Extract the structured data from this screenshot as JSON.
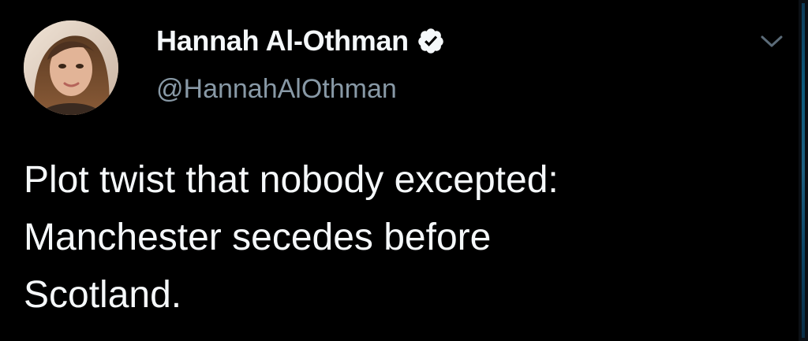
{
  "tweet": {
    "author": {
      "display_name": "Hannah Al-Othman",
      "handle": "@HannahAlOthman",
      "verified": true,
      "avatar_icon": "profile-photo"
    },
    "text": "Plot twist that nobody excepted:\nManchester secedes before\nScotland.",
    "more_menu_icon": "chevron-down-icon"
  },
  "colors": {
    "background": "#000000",
    "primary_text": "#f5f8fa",
    "secondary_text": "#8899a6",
    "verified_badge": "#f5f8fa"
  }
}
